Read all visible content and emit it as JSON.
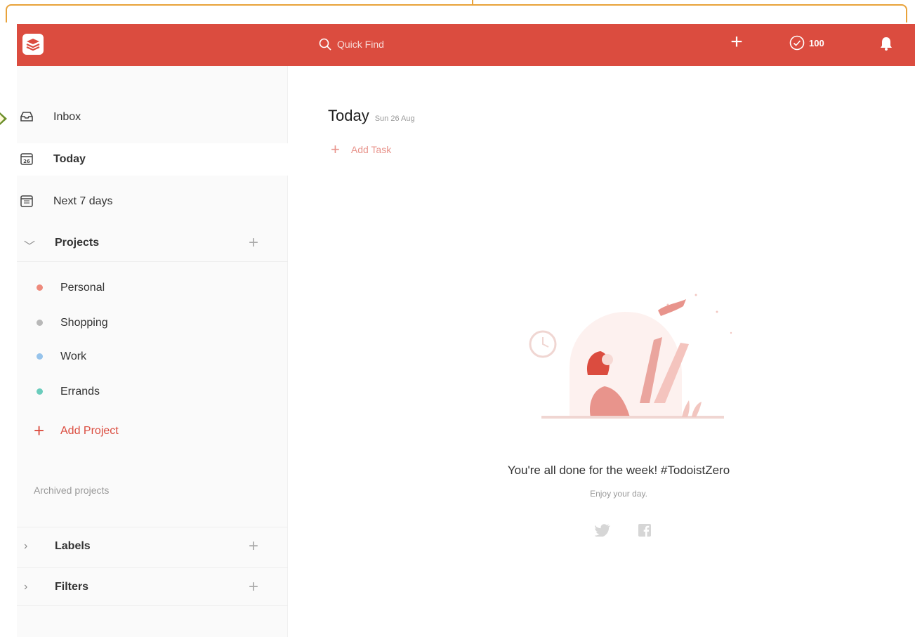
{
  "topbar": {
    "search_placeholder": "Quick Find",
    "karma_count": "100",
    "brand_color": "#db4c3f"
  },
  "sidebar": {
    "items": [
      {
        "label": "Inbox",
        "icon": "inbox-icon"
      },
      {
        "label": "Today",
        "icon": "calendar-today-icon"
      },
      {
        "label": "Next 7 days",
        "icon": "calendar-week-icon"
      }
    ],
    "projects_label": "Projects",
    "projects": [
      {
        "label": "Personal",
        "color": "#ee8a7c"
      },
      {
        "label": "Shopping",
        "color": "#b8b8b8"
      },
      {
        "label": "Work",
        "color": "#96c3eb"
      },
      {
        "label": "Errands",
        "color": "#6accbc"
      }
    ],
    "add_project_label": "Add Project",
    "archived_label": "Archived projects",
    "labels_label": "Labels",
    "filters_label": "Filters"
  },
  "main": {
    "title": "Today",
    "date": "Sun 26 Aug",
    "add_task_label": "Add Task",
    "empty_title": "You're all done for the week! #TodoistZero",
    "empty_subtitle": "Enjoy your day."
  }
}
